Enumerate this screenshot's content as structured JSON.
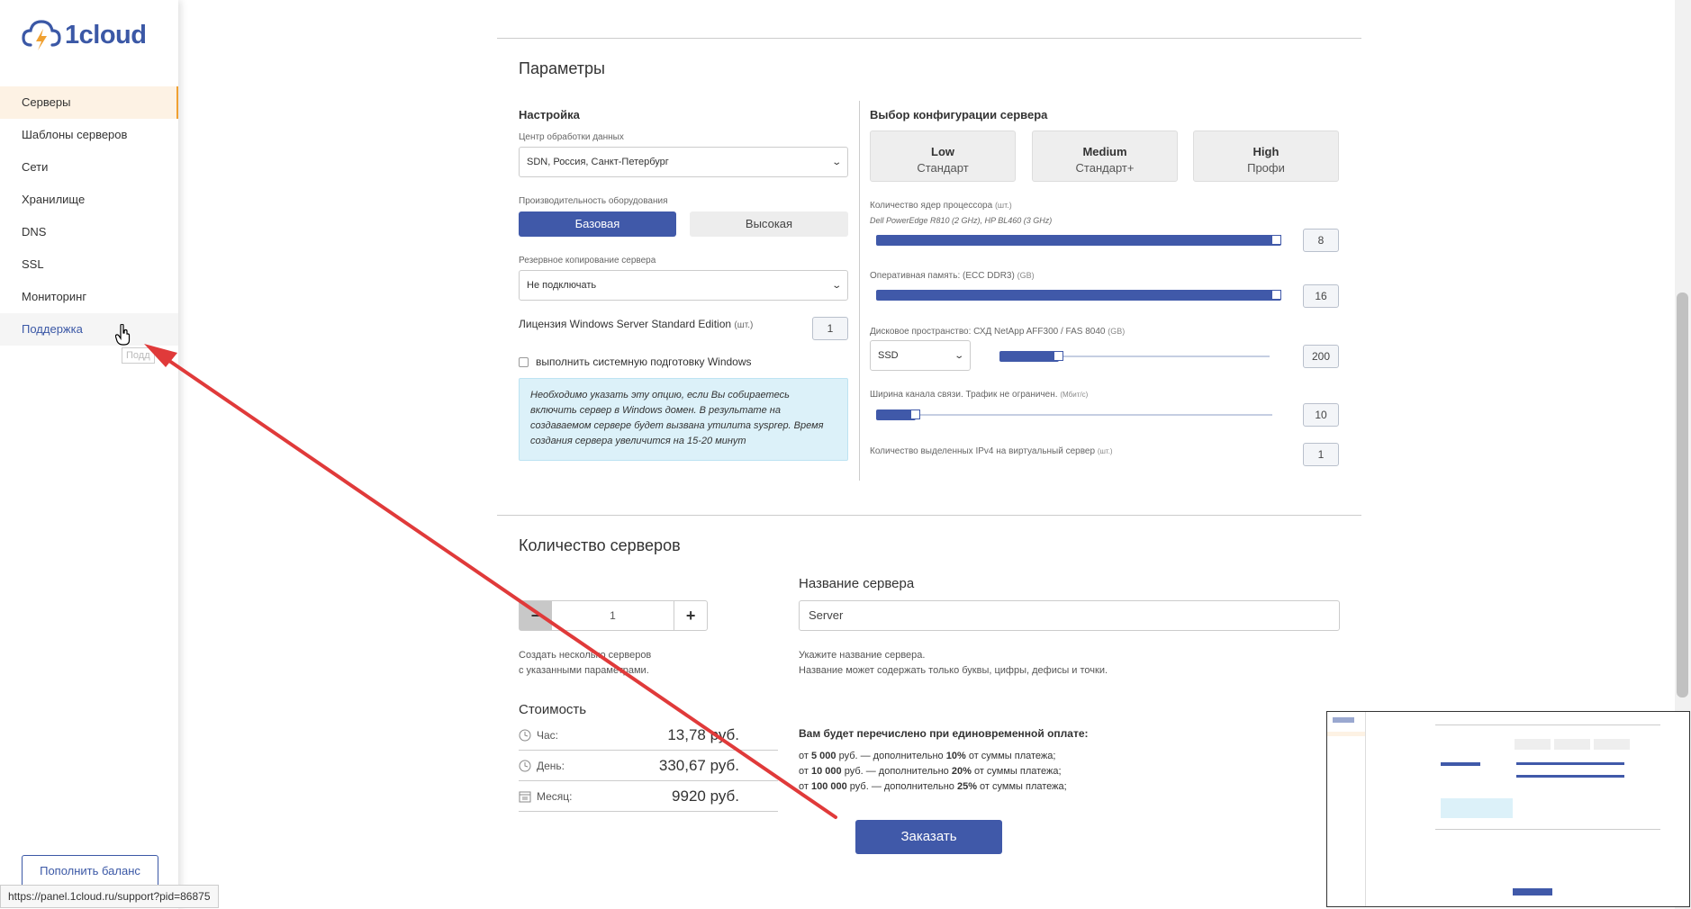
{
  "brand": {
    "name": "1cloud"
  },
  "sidebar": {
    "items": [
      {
        "label": "Серверы"
      },
      {
        "label": "Шаблоны серверов"
      },
      {
        "label": "Сети"
      },
      {
        "label": "Хранилище"
      },
      {
        "label": "DNS"
      },
      {
        "label": "SSL"
      },
      {
        "label": "Мониторинг"
      },
      {
        "label": "Поддержка"
      }
    ],
    "tooltip": "Подд",
    "balance_button": "Пополнить баланс"
  },
  "status_bar": {
    "url": "https://panel.1cloud.ru/support?pid=86875"
  },
  "params": {
    "title": "Параметры",
    "setup_title": "Настройка",
    "datacenter_label": "Центр обработки данных",
    "datacenter_value": "SDN, Россия, Санкт-Петербург",
    "performance_label": "Производительность оборудования",
    "perf_basic": "Базовая",
    "perf_high": "Высокая",
    "backup_label": "Резервное копирование сервера",
    "backup_value": "Не подключать",
    "license_label": "Лицензия Windows Server Standard Edition",
    "license_unit": "(шт.)",
    "license_value": "1",
    "sysprep_label": "выполнить системную подготовку Windows",
    "info_text": "Необходимо указать эту опцию, если Вы собираетесь включить сервер в Windows домен. В результате на создаваемом сервере будет вызвана утилита sysprep. Время создания сервера увеличится на 15-20 минут"
  },
  "config": {
    "title": "Выбор конфигурации сервера",
    "presets": [
      {
        "name": "Low",
        "type": "Стандарт"
      },
      {
        "name": "Medium",
        "type": "Стандарт+"
      },
      {
        "name": "High",
        "type": "Профи"
      }
    ],
    "cpu_label": "Количество ядер процессора",
    "cpu_unit": "(шт.)",
    "cpu_note": "Dell PowerEdge R810 (2 GHz), HP BL460 (3 GHz)",
    "cpu_value": "8",
    "cpu_level": 1.0,
    "ram_label": "Оперативная память: (ECC DDR3)",
    "ram_unit": "(GB)",
    "ram_value": "16",
    "ram_level": 1.0,
    "disk_label": "Дисковое пространство: СХД NetApp AFF300 / FAS 8040",
    "disk_unit": "(GB)",
    "disk_type": "SSD",
    "disk_value": "200",
    "disk_level": 0.22,
    "bandwidth_label": "Ширина канала связи. Трафик не ограничен.",
    "bandwidth_unit": "(Мбит/с)",
    "bandwidth_value": "10",
    "bandwidth_level": 0.1,
    "ipv4_label": "Количество выделенных IPv4 на виртуальный сервер",
    "ipv4_unit": "(шт.)",
    "ipv4_value": "1"
  },
  "servers": {
    "title": "Количество серверов",
    "qty_minus": "−",
    "qty_value": "1",
    "qty_plus": "+",
    "qty_hint_1": "Создать несколько серверов",
    "qty_hint_2": "с указанными параметрами.",
    "name_title": "Название сервера",
    "name_value": "Server",
    "name_hint_1": "Укажите название сервера.",
    "name_hint_2": "Название может содержать только буквы, цифры, дефисы и точки."
  },
  "cost": {
    "title": "Стоимость",
    "rows": [
      {
        "label": "Час:",
        "value": "13,78 руб."
      },
      {
        "label": "День:",
        "value": "330,67 руб."
      },
      {
        "label": "Месяц:",
        "value": "9920 руб."
      }
    ]
  },
  "bonus": {
    "title": "Вам будет перечислено при единовременной оплате:",
    "lines": [
      {
        "prefix": "от ",
        "amount": "5 000",
        "mid": " руб. — дополнительно ",
        "pct": "10%",
        "suffix": " от суммы платежа;"
      },
      {
        "prefix": "от ",
        "amount": "10 000",
        "mid": " руб. — дополнительно ",
        "pct": "20%",
        "suffix": " от суммы платежа;"
      },
      {
        "prefix": "от ",
        "amount": "100 000",
        "mid": " руб. — дополнительно ",
        "pct": "25%",
        "suffix": " от суммы платежа;"
      }
    ]
  },
  "order_button": "Заказать",
  "colors": {
    "accent": "#4059a9",
    "arrow": "#e03a3a",
    "active_nav": "#fdf2e4"
  }
}
